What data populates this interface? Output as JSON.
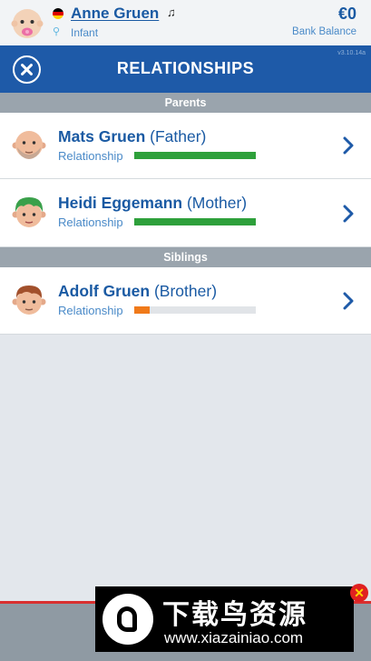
{
  "header": {
    "name": "Anne Gruen",
    "life_stage": "Infant",
    "money": "€0",
    "money_label": "Bank Balance",
    "flag_colors": [
      "#000000",
      "#dd0000",
      "#ffce00"
    ]
  },
  "titlebar": {
    "title": "RELATIONSHIPS",
    "version": "v3.10.14a"
  },
  "sections": {
    "parents": "Parents",
    "siblings": "Siblings"
  },
  "relationships": [
    {
      "name": "Mats Gruen",
      "relation": "(Father)",
      "label": "Relationship",
      "level": 1.0,
      "bar_color": "#2ea03b",
      "icon": "bald-man-face-icon"
    },
    {
      "name": "Heidi Eggemann",
      "relation": "(Mother)",
      "label": "Relationship",
      "level": 1.0,
      "bar_color": "#2ea03b",
      "icon": "green-hair-woman-face-icon"
    },
    {
      "name": "Adolf Gruen",
      "relation": "(Brother)",
      "label": "Relationship",
      "level": 0.13,
      "bar_color": "#f07a1a",
      "icon": "brown-hair-boy-face-icon"
    }
  ],
  "ad": {
    "chinese_text": "下载鸟资源",
    "url": "www.xiazainiao.com",
    "close_label": "✕"
  }
}
